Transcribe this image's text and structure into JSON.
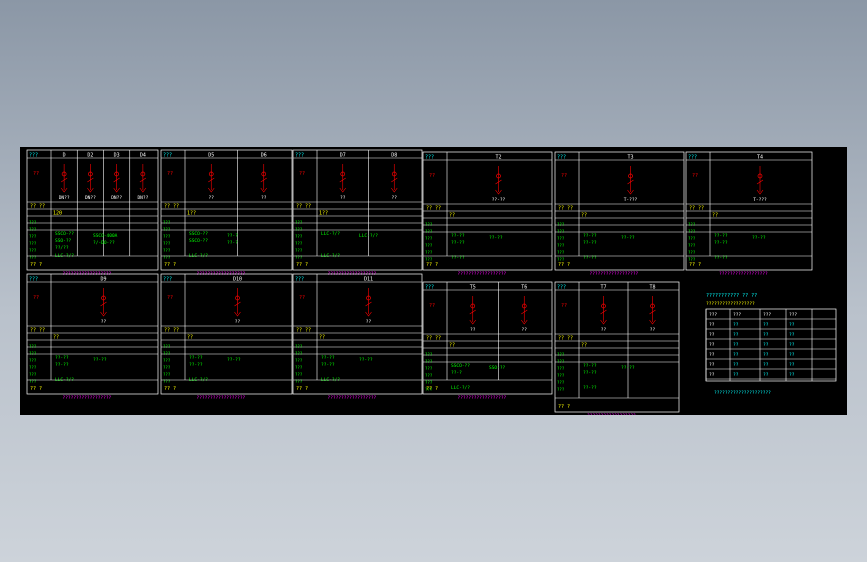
{
  "colors": {
    "background": "#000000",
    "frame": "#ffffff",
    "title": "#00ffff",
    "headers": "#ffff00",
    "symbols": "#ff0000",
    "specs": "#00ff00",
    "footer": "#ff00ff",
    "page_bg": "#9aa4b1"
  },
  "panels": [
    {
      "head_label": "???",
      "cols": [
        "D",
        "D2",
        "D3",
        "D4"
      ],
      "tag": "DN??",
      "rating": "120",
      "specs": [
        "SSCO-??",
        "SSCO-400A",
        "SSO-??",
        "?/-DO-??",
        "??/??"
      ],
      "spec_tail": "LLC-?/?",
      "footer": "??????????????????"
    },
    {
      "head_label": "???",
      "cols": [
        "D5",
        "D6"
      ],
      "tag": "??",
      "rating": "1??",
      "specs": [
        "SSCO-??",
        "??-?",
        "SSCO-??",
        "??-?"
      ],
      "spec_tail": "LLC-?/?",
      "footer": "??????????????????"
    },
    {
      "head_label": "???",
      "cols": [
        "D7",
        "D8"
      ],
      "tag": "??",
      "rating": "1??",
      "specs": [
        "LLC-?/?",
        "LLC-?/?"
      ],
      "spec_tail": "LLC-?/?",
      "footer": "??????????????????"
    },
    {
      "head_label": "???",
      "cols": [
        "T2"
      ],
      "tag": "??-??",
      "rating": "??",
      "specs": [
        "??-??",
        "??-??",
        "??-??"
      ],
      "spec_tail": "??-??",
      "footer": "??????????????????"
    },
    {
      "head_label": "???",
      "cols": [
        "T3"
      ],
      "tag": "T-???",
      "rating": "??",
      "specs": [
        "??-??",
        "??-??",
        "??-??"
      ],
      "spec_tail": "??-??",
      "footer": "??????????????????"
    },
    {
      "head_label": "???",
      "cols": [
        "T4"
      ],
      "tag": "T-???",
      "rating": "??",
      "specs": [
        "??-??",
        "??-??",
        "??-??"
      ],
      "spec_tail": "??-??",
      "footer": "??????????????????"
    },
    {
      "head_label": "???",
      "cols": [
        "D9"
      ],
      "tag": "??",
      "rating": "??",
      "specs": [
        "??-??",
        "??-??",
        "??-??"
      ],
      "spec_tail": "LLC-?/?",
      "footer": "??????????????????"
    },
    {
      "head_label": "???",
      "cols": [
        "D10"
      ],
      "tag": "??",
      "rating": "??",
      "specs": [
        "??-??",
        "??-??",
        "??-??"
      ],
      "spec_tail": "LLC-?/?",
      "footer": "??????????????????"
    },
    {
      "head_label": "???",
      "cols": [
        "D11"
      ],
      "tag": "??",
      "rating": "??",
      "specs": [
        "??-??",
        "??-??",
        "??-??"
      ],
      "spec_tail": "LLC-?/?",
      "footer": "??????????????????"
    },
    {
      "head_label": "???",
      "cols": [
        "T5",
        "T6"
      ],
      "tag": "??",
      "rating": "??",
      "specs": [
        "SSCO-??",
        "SSO-??",
        "??-?"
      ],
      "spec_tail": "LLC-?/?",
      "footer": "??????????????????"
    },
    {
      "head_label": "???",
      "cols": [
        "T7",
        "T8"
      ],
      "tag": "??",
      "rating": "??",
      "specs": [
        "??-??",
        "??-??",
        "??-??"
      ],
      "spec_tail": "??-??",
      "footer": "??????????????????"
    }
  ],
  "legend_table": {
    "title": "??????????? ?? ??",
    "subtitle": "??????????????????",
    "header": [
      "???",
      "???",
      "???",
      "???"
    ],
    "rows": [
      [
        "??",
        "??",
        "??",
        "??"
      ],
      [
        "??",
        "??",
        "??",
        "??"
      ],
      [
        "??",
        "??",
        "??",
        "??"
      ],
      [
        "??",
        "??",
        "??",
        "??"
      ],
      [
        "??",
        "??",
        "??",
        "??"
      ],
      [
        "??",
        "??",
        "??",
        "??"
      ]
    ],
    "note": "?????????????????????"
  }
}
